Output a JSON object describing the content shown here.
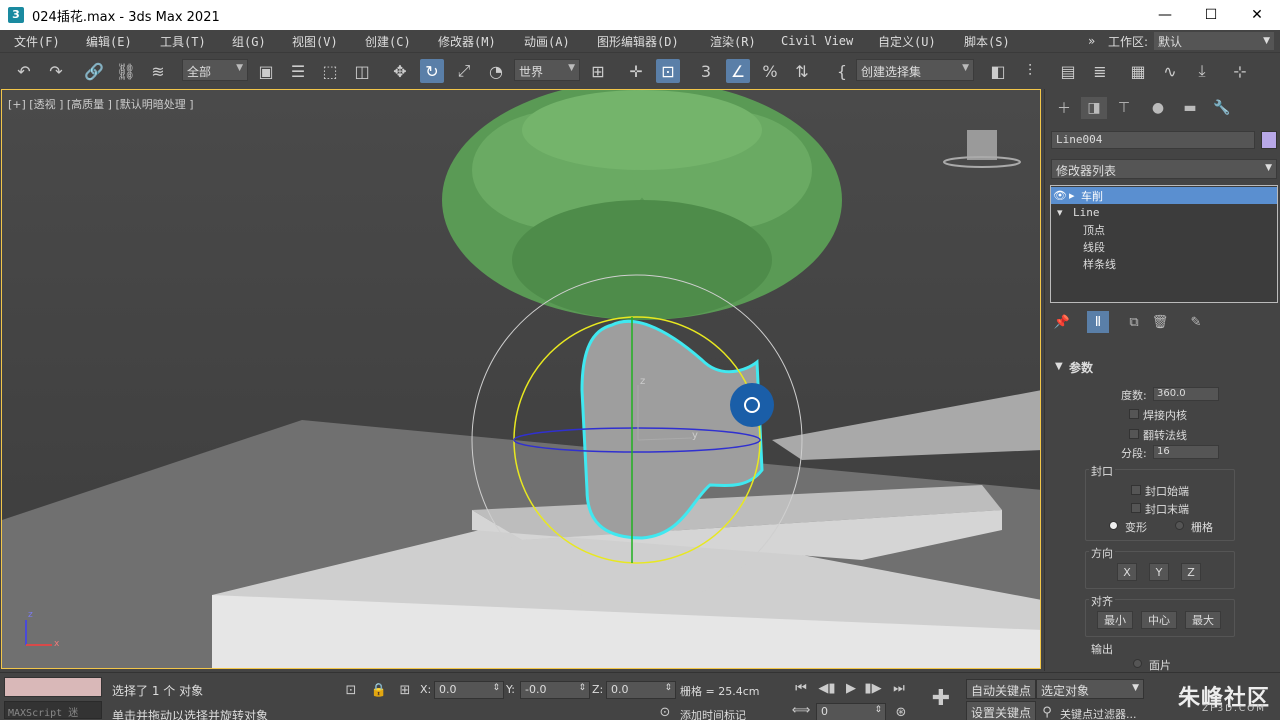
{
  "window": {
    "app_icon_letter": "3",
    "title": "024插花.max - 3ds Max 2021",
    "minimize": "—",
    "maximize": "☐",
    "close": "✕"
  },
  "menubar": {
    "items": [
      "文件(F)",
      "编辑(E)",
      "工具(T)",
      "组(G)",
      "视图(V)",
      "创建(C)",
      "修改器(M)",
      "动画(A)",
      "图形编辑器(D)",
      "渲染(R)",
      "Civil View",
      "自定义(U)",
      "脚本(S)"
    ],
    "overflow": "»",
    "workspace_label": "工作区:",
    "workspace_value": "默认"
  },
  "toolbar": {
    "selection_filter": "全部",
    "reference_coord": "世界",
    "named_selection": "创建选择集"
  },
  "viewport": {
    "label": "[+] [透视 ] [高质量 ] [默认明暗处理 ]",
    "gizmo_axis_y": "y",
    "gizmo_axis_z": "z",
    "corner_axis_z": "z",
    "corner_axis_x": "x"
  },
  "command_panel": {
    "object_name": "Line004",
    "object_color": "#b8a8e8",
    "modifier_list_label": "修改器列表",
    "stack": [
      {
        "label": "车削",
        "selected": true
      },
      {
        "label": "Line",
        "selected": false
      },
      {
        "label": "顶点",
        "selected": false
      },
      {
        "label": "线段",
        "selected": false
      },
      {
        "label": "样条线",
        "selected": false
      }
    ],
    "rollout": {
      "title": "参数",
      "degrees_label": "度数:",
      "degrees_value": "360.0",
      "weld_core": "焊接内核",
      "flip_normals": "翻转法线",
      "segments_label": "分段:",
      "segments_value": "16",
      "capping_title": "封口",
      "cap_start": "封口始端",
      "cap_end": "封口末端",
      "morph": "变形",
      "grid": "栅格",
      "direction_title": "方向",
      "dir_x": "X",
      "dir_y": "Y",
      "dir_z": "Z",
      "align_title": "对齐",
      "align_min": "最小",
      "align_center": "中心",
      "align_max": "最大",
      "output_title": "输出",
      "output_patch": "面片"
    }
  },
  "statusbar": {
    "maxscript": "MAXScript 迷",
    "selection_status": "选择了 1 个 对象",
    "prompt": "单击并拖动以选择并旋转对象",
    "x_label": "X:",
    "x_value": "0.0",
    "y_label": "Y:",
    "y_value": "-0.0",
    "z_label": "Z:",
    "z_value": "0.0",
    "grid": "栅格 = 25.4cm",
    "add_time_tag": "添加时间标记",
    "auto_key": "自动关键点",
    "set_key": "设置关键点",
    "selected_object": "选定对象",
    "key_filters": "关键点过滤器...",
    "frame": "0"
  },
  "watermark": {
    "text": "朱峰社区",
    "sub": "ZF3D.COM"
  }
}
